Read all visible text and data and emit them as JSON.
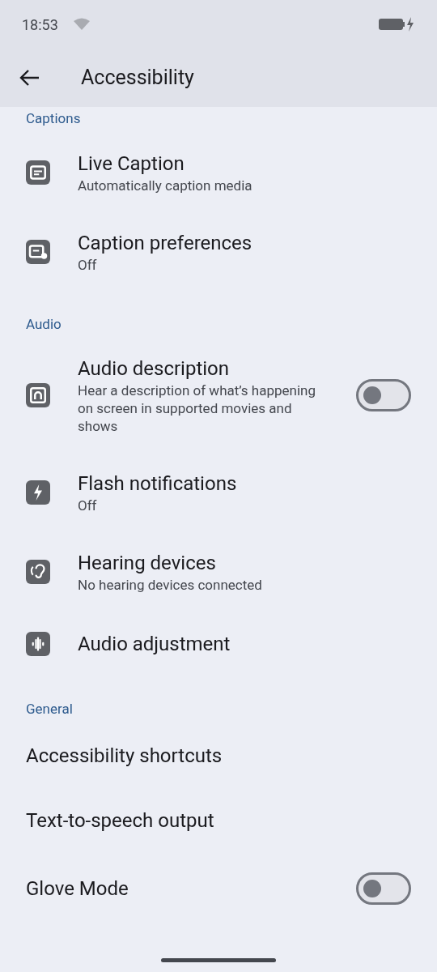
{
  "status_bar": {
    "time": "18:53"
  },
  "header": {
    "title": "Accessibility"
  },
  "sections": [
    {
      "title": "Captions",
      "items": [
        {
          "kind": "link",
          "title": "Live Caption",
          "subtitle": "Automatically caption media"
        },
        {
          "kind": "link",
          "title": "Caption preferences",
          "subtitle": "Off"
        }
      ]
    },
    {
      "title": "Audio",
      "items": [
        {
          "kind": "toggle",
          "title": "Audio description",
          "subtitle": "Hear a description of what’s happening on screen in supported movies and shows",
          "on": false
        },
        {
          "kind": "link",
          "title": "Flash notifications",
          "subtitle": "Off"
        },
        {
          "kind": "link",
          "title": "Hearing devices",
          "subtitle": "No hearing devices connected"
        },
        {
          "kind": "link",
          "title": "Audio adjustment"
        }
      ]
    },
    {
      "title": "General",
      "items": [
        {
          "kind": "link",
          "title": "Accessibility shortcuts"
        },
        {
          "kind": "link",
          "title": "Text-to-speech output"
        },
        {
          "kind": "toggle",
          "title": "Glove Mode",
          "on": false
        }
      ]
    }
  ]
}
